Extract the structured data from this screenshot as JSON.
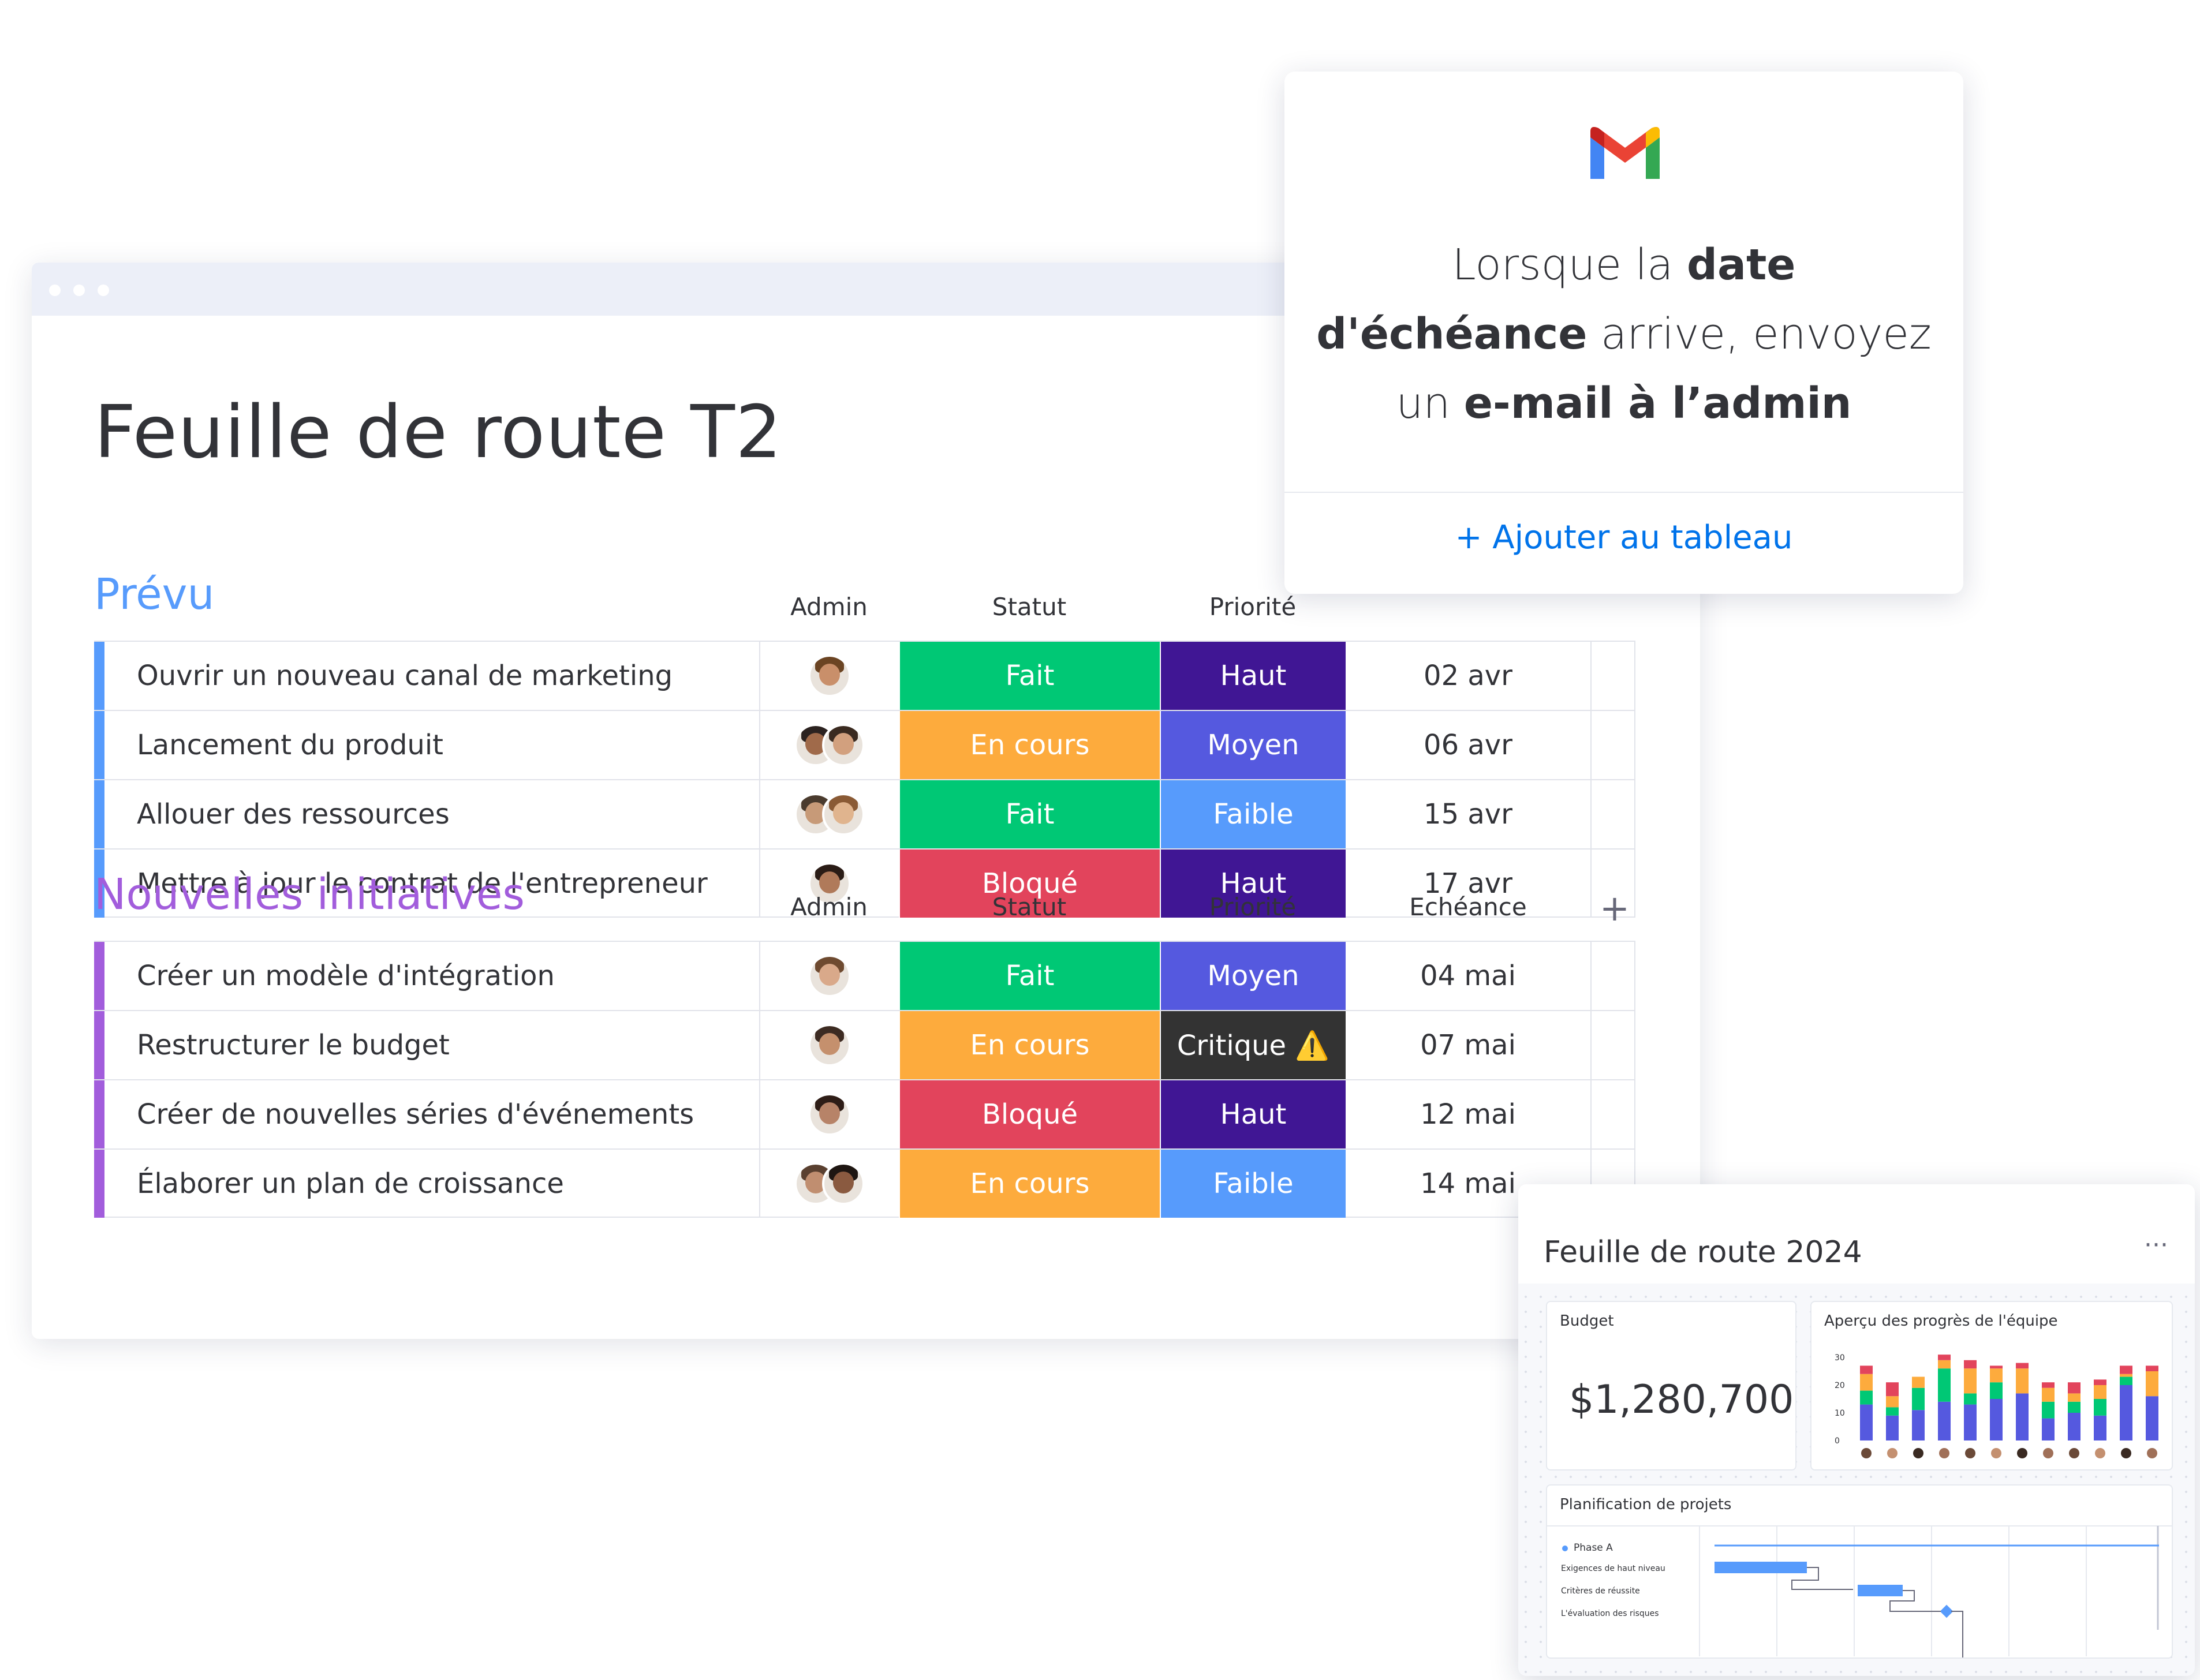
{
  "board": {
    "title": "Feuille de route T2",
    "groups": [
      {
        "title": "Prévu",
        "color": "#579bfc",
        "columns": {
          "admin": "Admin",
          "status": "Statut",
          "priority": "Priorité",
          "due": ""
        },
        "rows": [
          {
            "name": "Ouvrir un nouveau canal de marketing",
            "status": "Fait",
            "priority": "Haut",
            "due": "02 avr"
          },
          {
            "name": "Lancement du produit",
            "status": "En cours",
            "priority": "Moyen",
            "due": "06 avr"
          },
          {
            "name": "Allouer des ressources",
            "status": "Fait",
            "priority": "Faible",
            "due": "15 avr"
          },
          {
            "name": "Mettre à jour le contrat de l'entrepreneur",
            "status": "Bloqué",
            "priority": "Haut",
            "due": "17 avr"
          }
        ]
      },
      {
        "title": "Nouvelles initiatives",
        "color": "#a25ddc",
        "columns": {
          "admin": "Admin",
          "status": "Statut",
          "priority": "Priorité",
          "due": "Echéance",
          "add": "+"
        },
        "rows": [
          {
            "name": "Créer un modèle d'intégration",
            "status": "Fait",
            "priority": "Moyen",
            "due": "04 mai"
          },
          {
            "name": "Restructurer le budget",
            "status": "En cours",
            "priority": "Critique ⚠️",
            "due": "07 mai"
          },
          {
            "name": "Créer de nouvelles séries d'événements",
            "status": "Bloqué",
            "priority": "Haut",
            "due": "12 mai"
          },
          {
            "name": "Élaborer un plan de croissance",
            "status": "En cours",
            "priority": "Faible",
            "due": "14 mai"
          }
        ]
      }
    ]
  },
  "colors": {
    "Fait": "#00c875",
    "En cours": "#fdab3d",
    "Bloqué": "#e2445c",
    "Haut": "#401694",
    "Moyen": "#5559df",
    "Faible": "#579bfc",
    "Critique": "#333333"
  },
  "automation_card": {
    "icon": "gmail-icon",
    "text_1": "Lorsque la ",
    "text_2": "date",
    "text_3": "d'échéance",
    "text_4": " arrive, envoyez",
    "text_5": "un ",
    "text_6": "e-mail à l’admin",
    "action": "+ Ajouter au tableau"
  },
  "dashboard": {
    "title": "Feuille de route 2024",
    "menu": "···",
    "budget": {
      "label": "Budget",
      "value": "$1,280,700"
    },
    "progress": {
      "label": "Aperçu des progrès de l'équipe",
      "y_ticks": [
        "30",
        "20",
        "10",
        "0"
      ]
    },
    "planning": {
      "label": "Planification de projets",
      "phase": "Phase A",
      "tasks": [
        "Exigences de haut niveau",
        "Critères de réussite",
        "L'évaluation des risques"
      ]
    }
  },
  "chart_data": {
    "type": "bar",
    "stacked": true,
    "ylim": [
      0,
      30
    ],
    "categories": [
      "1",
      "2",
      "3",
      "4",
      "5",
      "6",
      "7",
      "8",
      "9",
      "10",
      "11",
      "12"
    ],
    "series": [
      {
        "values": [
          13,
          9,
          11,
          14,
          13,
          15,
          17,
          8,
          10,
          9,
          20,
          16
        ],
        "color": "#5559df"
      },
      {
        "values": [
          5,
          3,
          8,
          12,
          4,
          6,
          0,
          6,
          4,
          6,
          3,
          0
        ],
        "color": "#00c875"
      },
      {
        "values": [
          6,
          4,
          4,
          3,
          9,
          5,
          9,
          5,
          3,
          5,
          1,
          9
        ],
        "color": "#fdab3d"
      },
      {
        "values": [
          3,
          5,
          0,
          2,
          3,
          1,
          2,
          2,
          4,
          2,
          3,
          2
        ],
        "color": "#e2445c"
      }
    ]
  }
}
